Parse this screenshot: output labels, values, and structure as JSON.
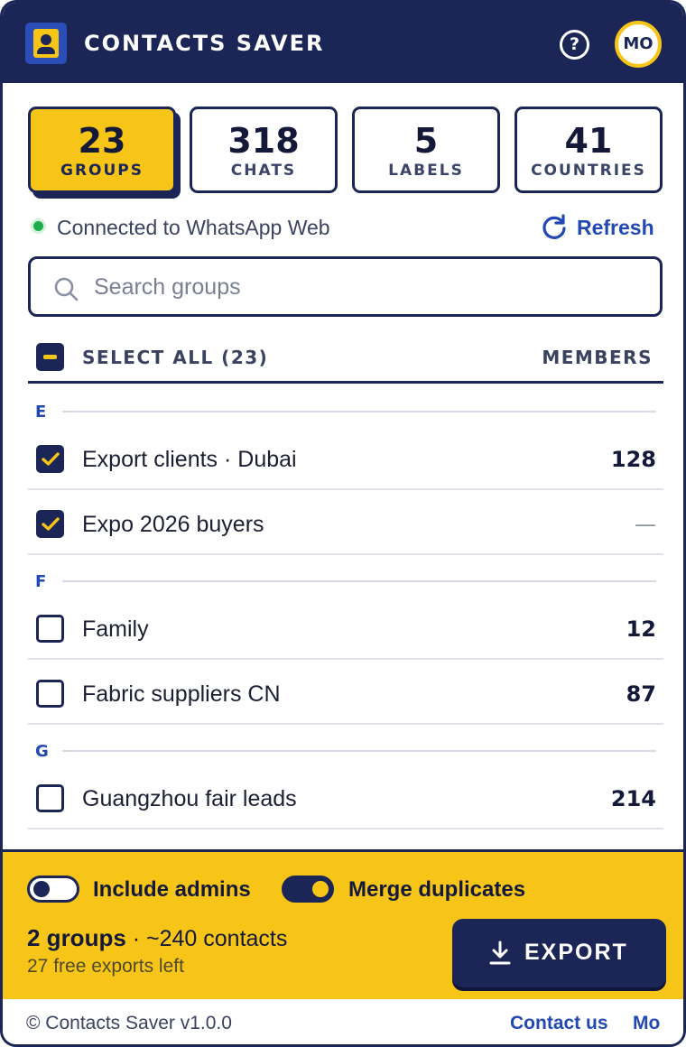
{
  "header": {
    "title": "CONTACTS SAVER",
    "help_glyph": "?",
    "avatar_initials": "MO"
  },
  "stats": [
    {
      "value": "23",
      "label": "GROUPS",
      "active": true
    },
    {
      "value": "318",
      "label": "CHATS",
      "active": false
    },
    {
      "value": "5",
      "label": "LABELS",
      "active": false
    },
    {
      "value": "41",
      "label": "COUNTRIES",
      "active": false
    }
  ],
  "status": {
    "text": "Connected to WhatsApp Web",
    "refresh_label": "Refresh"
  },
  "search": {
    "placeholder": "Search groups",
    "value": ""
  },
  "list_header": {
    "select_all": "SELECT ALL (23)",
    "members": "MEMBERS"
  },
  "sections": [
    {
      "letter": "E",
      "items": [
        {
          "name": "Export clients · Dubai",
          "members": "128",
          "checked": true
        },
        {
          "name": "Expo 2026 buyers",
          "members": "—",
          "checked": true
        }
      ]
    },
    {
      "letter": "F",
      "items": [
        {
          "name": "Family",
          "members": "12",
          "checked": false
        },
        {
          "name": "Fabric suppliers CN",
          "members": "87",
          "checked": false
        }
      ]
    },
    {
      "letter": "G",
      "items": [
        {
          "name": "Guangzhou fair leads",
          "members": "214",
          "checked": false
        }
      ]
    }
  ],
  "options": {
    "include_admins": {
      "label": "Include admins",
      "on": false
    },
    "merge_duplicates": {
      "label": "Merge duplicates",
      "on": true
    }
  },
  "summary": {
    "groups": "2 groups",
    "contacts": " · ~240 contacts",
    "free_exports": "27 free exports left"
  },
  "export_label": "EXPORT",
  "footer": {
    "copyright": "© Contacts Saver v1.0.0",
    "contact_link": "Contact us",
    "user_link": "Mo"
  },
  "colors": {
    "navy": "#1b2656",
    "yellow": "#f6c518",
    "link_blue": "#2248b3",
    "online_green": "#1fae4b"
  },
  "icons": [
    "contacts-logo-icon",
    "help-icon",
    "refresh-icon",
    "search-icon",
    "minus-icon",
    "check-icon",
    "download-icon"
  ]
}
